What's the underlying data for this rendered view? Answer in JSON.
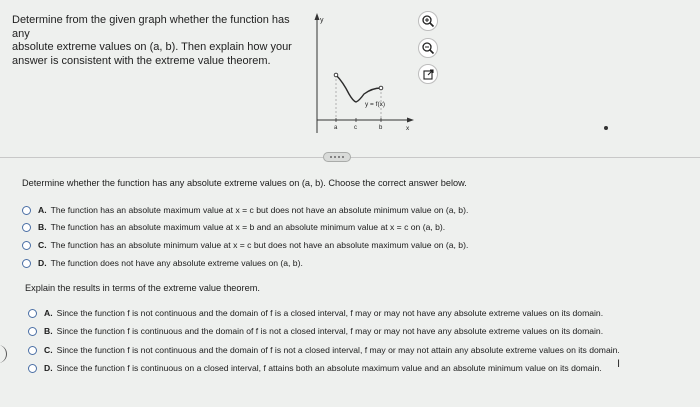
{
  "question_prompt": {
    "lines": [
      "Determine from the given graph whether the function has any",
      "absolute extreme values on (a, b). Then explain how your",
      "answer is consistent with the extreme value theorem."
    ]
  },
  "graph": {
    "y_axis_label": "y",
    "x_axis_label": "x",
    "function_label": "y = f(x)",
    "tick_labels": [
      "a",
      "c",
      "b"
    ]
  },
  "tools": {
    "icons": [
      "zoom-in-icon",
      "zoom-out-icon",
      "open-external-icon"
    ]
  },
  "part1": {
    "prompt": "Determine whether the function has any absolute extreme values on (a, b). Choose the correct answer below.",
    "options": [
      {
        "letter": "A.",
        "text": "The function has an absolute maximum value at x = c but does not have an absolute minimum value on (a, b)."
      },
      {
        "letter": "B.",
        "text": "The function has an absolute maximum value at x = b and an absolute minimum value at x = c on (a, b)."
      },
      {
        "letter": "C.",
        "text": "The function has an absolute minimum value at x = c but does not have an absolute maximum value on (a, b)."
      },
      {
        "letter": "D.",
        "text": "The function does not have any absolute extreme values on (a, b)."
      }
    ]
  },
  "part2": {
    "prompt": "Explain the results in terms of the extreme value theorem.",
    "options": [
      {
        "letter": "A.",
        "text": "Since the function f is not continuous and the domain of f is a closed interval, f may or may not have any absolute extreme values on its domain."
      },
      {
        "letter": "B.",
        "text": "Since the function f is continuous and the domain of f is not a closed interval, f may or may not have any absolute extreme values on its domain."
      },
      {
        "letter": "C.",
        "text": "Since the function f is not continuous and the domain of f is not a closed interval, f may or may not attain any absolute extreme values on its domain."
      },
      {
        "letter": "D.",
        "text": "Since the function f is continuous on a closed interval, f attains both an absolute maximum value and an absolute minimum value on its domain."
      }
    ]
  },
  "colors": {
    "background": "#eef0ee",
    "radio_border": "#4a6fa5",
    "curve": "#2b2b2b"
  }
}
